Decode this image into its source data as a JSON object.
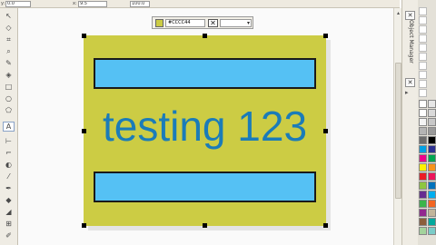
{
  "property_bar": {
    "y_field": "0.0",
    "x_field": "9.5",
    "scale_field": "100.0",
    "y_label": "y:",
    "x_label": "x:"
  },
  "color_toolbar": {
    "hex_value": "#CCCC44",
    "dropdown_arrow": "▾",
    "current_color": "#CCCC44"
  },
  "canvas": {
    "art_text": "testing 123"
  },
  "docker": {
    "tab_label": "Object Manager",
    "close_glyph": "✕",
    "arrow_glyph": "▸"
  },
  "palette": {
    "colors": [
      "#ffffff",
      "#e6e6e6",
      "#ffffff",
      "#d9d9d9",
      "#f4f4f4",
      "#c8c8c8",
      "#b4b4b4",
      "#999999",
      "#6b6b6b",
      "#000000",
      "#00a0e3",
      "#2e3192",
      "#ec008c",
      "#00a651",
      "#fff200",
      "#f7941d",
      "#ed1c24",
      "#ed145b",
      "#8dc63f",
      "#0072bc",
      "#662d91",
      "#00aeef",
      "#39b54a",
      "#f26522",
      "#92278f",
      "#c2b59b",
      "#8b5e3c",
      "#00a99d",
      "#a3d39c",
      "#7accc8"
    ]
  }
}
